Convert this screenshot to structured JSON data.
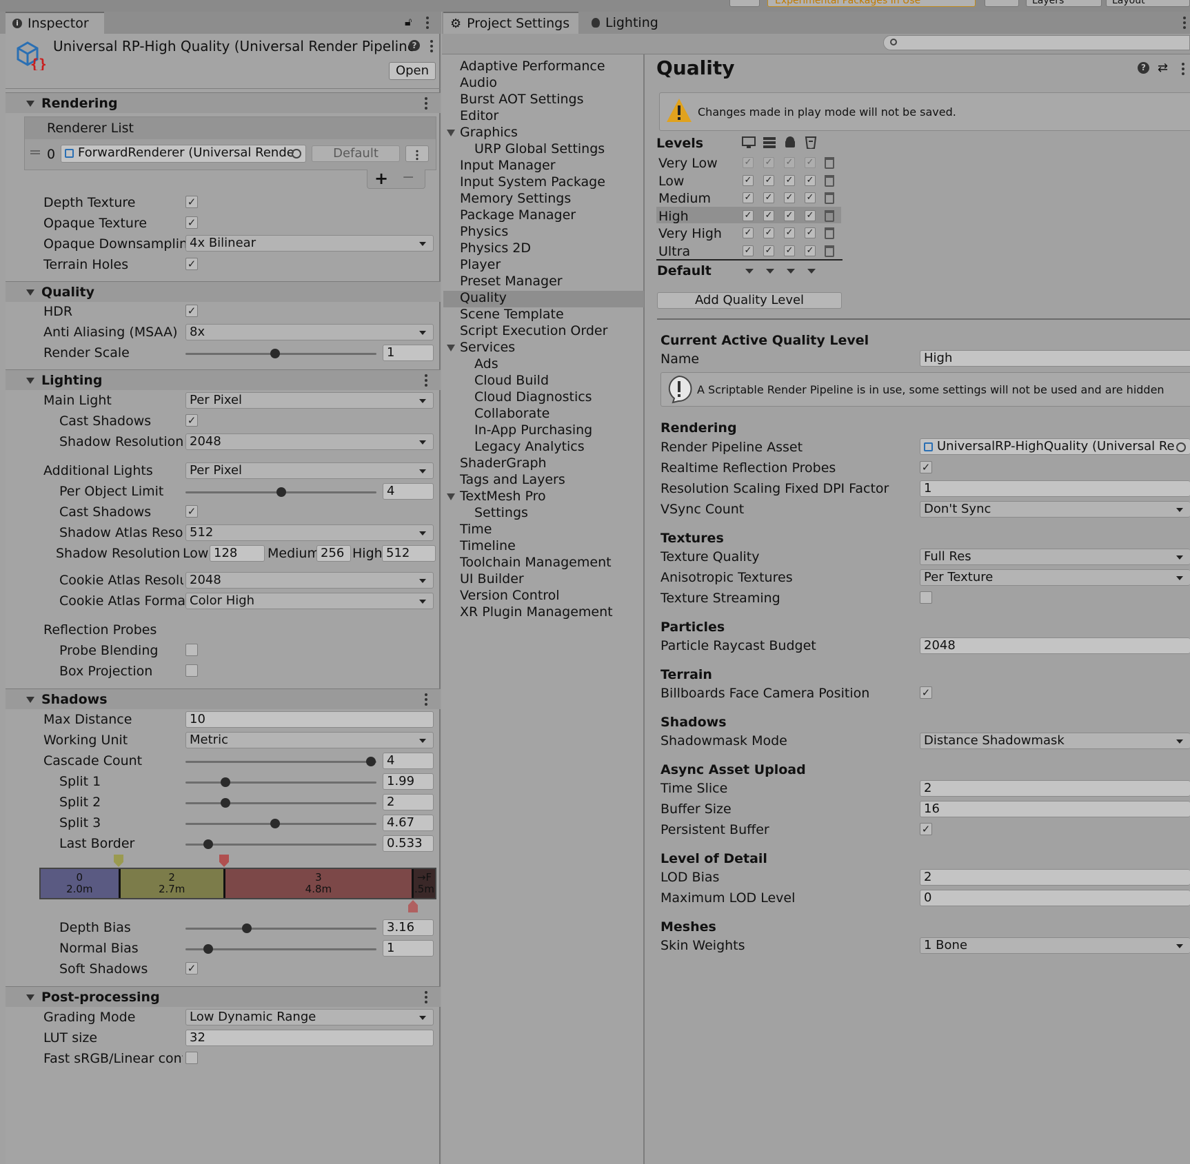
{
  "top_toolbar": {
    "packages_label": "Experimental Packages In Use",
    "layers_label": "Layers",
    "layout_label": "Layout"
  },
  "inspector": {
    "tab_label": "Inspector",
    "asset_title": "Universal RP-High Quality (Universal Render Pipeline",
    "open_button": "Open",
    "rendering": {
      "header": "Rendering",
      "renderer_list_label": "Renderer List",
      "renderer_index": "0",
      "renderer_name": "ForwardRenderer (Universal Rende",
      "default_button": "Default",
      "plus": "+",
      "minus": "−",
      "depth_texture": "Depth Texture",
      "opaque_texture": "Opaque Texture",
      "opaque_downsampling": "Opaque Downsampling",
      "opaque_downsampling_value": "4x Bilinear",
      "terrain_holes": "Terrain Holes"
    },
    "quality": {
      "header": "Quality",
      "hdr": "HDR",
      "msaa": "Anti Aliasing (MSAA)",
      "msaa_value": "8x",
      "render_scale": "Render Scale",
      "render_scale_value": "1",
      "render_scale_fraction": 0.47
    },
    "lighting": {
      "header": "Lighting",
      "main_light": "Main Light",
      "main_light_value": "Per Pixel",
      "cast_shadows": "Cast Shadows",
      "shadow_resolution": "Shadow Resolution",
      "shadow_resolution_value": "2048",
      "additional_lights": "Additional Lights",
      "additional_lights_value": "Per Pixel",
      "per_object_limit": "Per Object Limit",
      "per_object_limit_value": "4",
      "per_object_fraction": 0.5,
      "cast_shadows_2": "Cast Shadows",
      "shadow_atlas": "Shadow Atlas Resolu",
      "shadow_atlas_value": "512",
      "shadow_res_tiers": "Shadow Resolution T",
      "tier_low": "Low",
      "tier_low_value": "128",
      "tier_medium": "Medium",
      "tier_medium_value": "256",
      "tier_high": "High",
      "tier_high_value": "512",
      "cookie_atlas_res": "Cookie Atlas Resolut",
      "cookie_atlas_res_value": "2048",
      "cookie_atlas_format": "Cookie Atlas Format",
      "cookie_atlas_format_value": "Color High",
      "reflection_probes": "Reflection Probes",
      "probe_blending": "Probe Blending",
      "box_projection": "Box Projection"
    },
    "shadows": {
      "header": "Shadows",
      "max_distance": "Max Distance",
      "max_distance_value": "10",
      "working_unit": "Working Unit",
      "working_unit_value": "Metric",
      "cascade_count": "Cascade Count",
      "cascade_count_value": "4",
      "cascade_fraction": 0.97,
      "split1": "Split 1",
      "split1_value": "1.99",
      "split1_fraction": 0.21,
      "split2": "Split 2",
      "split2_value": "2",
      "split2_fraction": 0.21,
      "split3": "Split 3",
      "split3_value": "4.67",
      "split3_fraction": 0.47,
      "last_border": "Last Border",
      "last_border_value": "0.533",
      "last_border_fraction": 0.12,
      "cascades": [
        {
          "index": "0",
          "dist": "2.0m",
          "color": "#5a5a82",
          "share": 0.2
        },
        {
          "index": "2",
          "dist": "2.7m",
          "color": "#7c7c4a",
          "share": 0.265
        },
        {
          "index": "3",
          "dist": "4.8m",
          "color": "#7c4848",
          "share": 0.48
        },
        {
          "index": "→F",
          "dist": ".5m",
          "color": "#3a2828",
          "share": 0.055
        }
      ],
      "depth_bias": "Depth Bias",
      "depth_bias_value": "3.16",
      "depth_bias_fraction": 0.32,
      "normal_bias": "Normal Bias",
      "normal_bias_value": "1",
      "normal_bias_fraction": 0.12,
      "soft_shadows": "Soft Shadows"
    },
    "post": {
      "header": "Post-processing",
      "grading_mode": "Grading Mode",
      "grading_mode_value": "Low Dynamic Range",
      "lut_size": "LUT size",
      "lut_size_value": "32",
      "fast_srgb": "Fast sRGB/Linear conve"
    }
  },
  "project_settings": {
    "tab_label": "Project Settings",
    "lighting_tab": "Lighting",
    "search_placeholder": "",
    "nav": [
      "Adaptive Performance",
      "Audio",
      "Burst AOT Settings",
      "Editor",
      "Graphics",
      "URP Global Settings",
      "Input Manager",
      "Input System Package",
      "Memory Settings",
      "Package Manager",
      "Physics",
      "Physics 2D",
      "Player",
      "Preset Manager",
      "Quality",
      "Scene Template",
      "Script Execution Order",
      "Services",
      "Ads",
      "Cloud Build",
      "Cloud Diagnostics",
      "Collaborate",
      "In-App Purchasing",
      "Legacy Analytics",
      "ShaderGraph",
      "Tags and Layers",
      "TextMesh Pro",
      "Settings",
      "Time",
      "Timeline",
      "Toolchain Management",
      "UI Builder",
      "Version Control",
      "XR Plugin Management"
    ],
    "quality": {
      "title": "Quality",
      "warning": "Changes made in play mode will not be saved.",
      "levels_label": "Levels",
      "levels": [
        "Very Low",
        "Low",
        "Medium",
        "High",
        "Very High",
        "Ultra"
      ],
      "default_label": "Default",
      "add_level": "Add Quality Level",
      "current_active": "Current Active Quality Level",
      "name_label": "Name",
      "name_value": "High",
      "srp_notice": "A Scriptable Render Pipeline is in use, some settings will not be used and are hidden",
      "rendering_hdr": "Rendering",
      "render_pipeline_asset": "Render Pipeline Asset",
      "render_pipeline_asset_value": "UniversalRP-HighQuality (Universal Re",
      "realtime_reflection": "Realtime Reflection Probes",
      "dpi_factor": "Resolution Scaling Fixed DPI Factor",
      "dpi_factor_value": "1",
      "vsync": "VSync Count",
      "vsync_value": "Don't Sync",
      "textures_hdr": "Textures",
      "texture_quality": "Texture Quality",
      "texture_quality_value": "Full Res",
      "anisotropic": "Anisotropic Textures",
      "anisotropic_value": "Per Texture",
      "texture_streaming": "Texture Streaming",
      "particles_hdr": "Particles",
      "raycast_budget": "Particle Raycast Budget",
      "raycast_budget_value": "2048",
      "terrain_hdr": "Terrain",
      "billboards": "Billboards Face Camera Position",
      "shadows_hdr": "Shadows",
      "shadowmask": "Shadowmask Mode",
      "shadowmask_value": "Distance Shadowmask",
      "async_hdr": "Async Asset Upload",
      "time_slice": "Time Slice",
      "time_slice_value": "2",
      "buffer_size": "Buffer Size",
      "buffer_size_value": "16",
      "persistent_buffer": "Persistent Buffer",
      "lod_hdr": "Level of Detail",
      "lod_bias": "LOD Bias",
      "lod_bias_value": "2",
      "max_lod": "Maximum LOD Level",
      "max_lod_value": "0",
      "meshes_hdr": "Meshes",
      "skin_weights": "Skin Weights",
      "skin_weights_value": "1 Bone"
    }
  }
}
